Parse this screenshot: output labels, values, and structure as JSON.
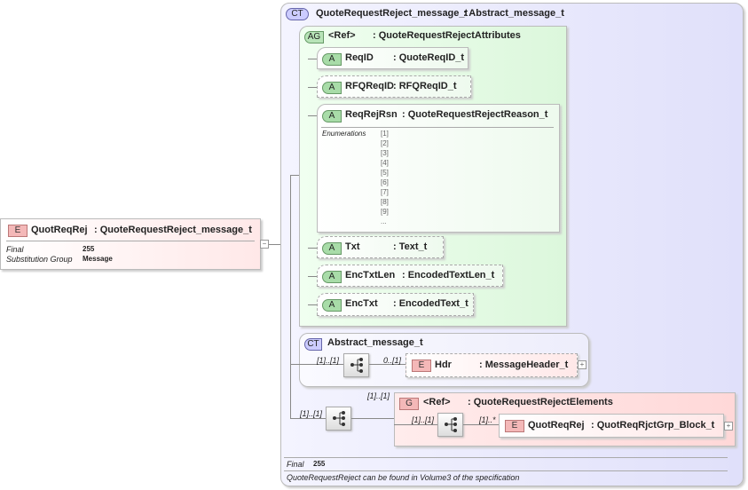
{
  "root": {
    "badge": "E",
    "name": "QuotReqRej",
    "type": ": QuoteRequestReject_message_t",
    "final_label": "Final",
    "final_value": "255",
    "subst_label": "Substitution Group",
    "subst_value": "Message",
    "collapse": "−"
  },
  "complex_type": {
    "badge": "CT",
    "name": "QuoteRequestReject_message_t",
    "base": ": Abstract_message_t",
    "final_label": "Final",
    "final_value": "255",
    "doc": "QuoteRequestReject can be found in Volume3 of the specification"
  },
  "attr_group": {
    "badge": "AG",
    "name": "<Ref>",
    "type": ": QuoteRequestRejectAttributes",
    "attributes": [
      {
        "badge": "A",
        "name": "ReqID",
        "type": ": QuoteReqID_t"
      },
      {
        "badge": "A",
        "name": "RFQReqID",
        "type": ": RFQReqID_t"
      },
      {
        "badge": "A",
        "name": "ReqRejRsn",
        "type": ": QuoteRequestRejectReason_t",
        "enum_label": "Enumerations",
        "enums": [
          "[1]",
          "[2]",
          "[3]",
          "[4]",
          "[5]",
          "[6]",
          "[7]",
          "[8]",
          "[9]",
          "..."
        ]
      },
      {
        "badge": "A",
        "name": "Txt",
        "type": ": Text_t"
      },
      {
        "badge": "A",
        "name": "EncTxtLen",
        "type": ": EncodedTextLen_t"
      },
      {
        "badge": "A",
        "name": "EncTxt",
        "type": ": EncodedText_t"
      }
    ]
  },
  "abstract": {
    "badge": "CT",
    "name": "Abstract_message_t",
    "seq_card": "[1]..[1]",
    "hdr_card": "0..[1]",
    "hdr": {
      "badge": "E",
      "name": "Hdr",
      "type": ": MessageHeader_t"
    }
  },
  "group": {
    "seq_card": "[1]..[1]",
    "group_card": "[1]..[1]",
    "badge": "G",
    "name": "<Ref>",
    "type": ": QuoteRequestRejectElements",
    "inner_seq_card": "[1]..[1]",
    "elem_card": "[1]..*",
    "elem": {
      "badge": "E",
      "name": "QuotReqRej",
      "type": ": QuotReqRjctGrp_Block_t"
    }
  },
  "plus": "+"
}
